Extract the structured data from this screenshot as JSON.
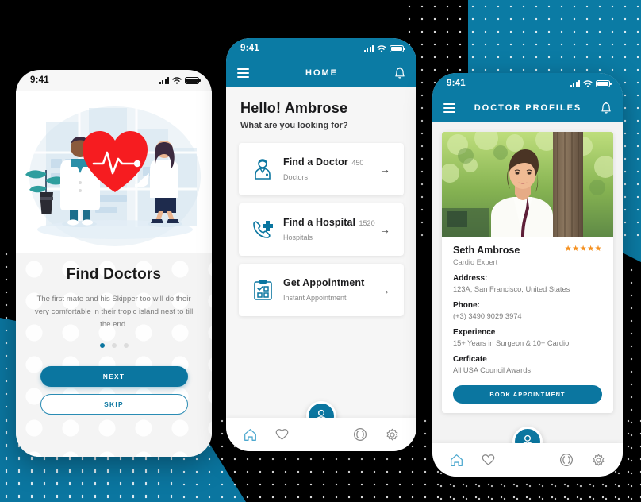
{
  "theme": {
    "accent": "#0b76a0",
    "header_teal": "#0b7ba4",
    "star_orange": "#f5901f",
    "background_black": "#000000",
    "card_white": "#ffffff"
  },
  "screen_onboarding": {
    "status": {
      "time": "9:41",
      "signal_icon": "signal-bars-icon",
      "wifi_icon": "wifi-icon",
      "battery_icon": "battery-icon"
    },
    "illustration": "doctors-heart-illustration",
    "title": "Find Doctors",
    "description": "The first mate and his Skipper too will do their very comfortable in their tropic island nest to till the end.",
    "pagination": {
      "total": 3,
      "active_index": 0
    },
    "primary_button": "NEXT",
    "secondary_button": "SKIP"
  },
  "screen_home": {
    "status": {
      "time": "9:41",
      "signal_icon": "signal-bars-icon",
      "wifi_icon": "wifi-icon",
      "battery_icon": "battery-icon"
    },
    "navbar": {
      "menu_icon": "hamburger-menu-icon",
      "title": "HOME",
      "bell_icon": "notification-bell-icon"
    },
    "greeting": "Hello! Ambrose",
    "subgreeting": "What are you looking for?",
    "cards": [
      {
        "icon": "doctor-icon",
        "title": "Find a Doctor",
        "subtitle": "450 Doctors",
        "arrow_icon": "arrow-right-icon"
      },
      {
        "icon": "phone-plus-icon",
        "title": "Find a Hospital",
        "subtitle": "1520 Hospitals",
        "arrow_icon": "arrow-right-icon"
      },
      {
        "icon": "clipboard-check-icon",
        "title": "Get Appointment",
        "subtitle": "Instant Appointment",
        "arrow_icon": "arrow-right-icon"
      }
    ],
    "tabbar": {
      "items": [
        {
          "icon": "home-icon",
          "active": true
        },
        {
          "icon": "heart-icon",
          "active": false
        },
        {
          "icon": "people-icon",
          "active": false
        },
        {
          "icon": "gear-icon",
          "active": false
        }
      ],
      "fab_icon": "doctor-avatar-icon"
    }
  },
  "screen_doctor_profile": {
    "status": {
      "time": "9:41",
      "signal_icon": "signal-bars-icon",
      "wifi_icon": "wifi-icon",
      "battery_icon": "battery-icon"
    },
    "navbar": {
      "menu_icon": "hamburger-menu-icon",
      "title": "DOCTOR PROFILES",
      "bell_icon": "notification-bell-icon"
    },
    "photo": "doctor-portrait-photo",
    "name": "Seth Ambrose",
    "role": "Cardio Expert",
    "rating": {
      "stars": "★★★★★",
      "value": 5
    },
    "fields": [
      {
        "label": "Address:",
        "value": "123A, San Francisco, United States"
      },
      {
        "label": "Phone:",
        "value": "(+3) 3490 9029 3974"
      },
      {
        "label": "Experience",
        "value": "15+ Years in Surgeon & 10+ Cardio"
      },
      {
        "label": "Cerficate",
        "value": "All USA Council Awards"
      }
    ],
    "book_button": "BOOK APPOINTMENT",
    "tabbar": {
      "items": [
        {
          "icon": "home-icon",
          "active": true
        },
        {
          "icon": "heart-icon",
          "active": false
        },
        {
          "icon": "people-icon",
          "active": false
        },
        {
          "icon": "gear-icon",
          "active": false
        }
      ],
      "fab_icon": "doctor-avatar-icon"
    }
  }
}
